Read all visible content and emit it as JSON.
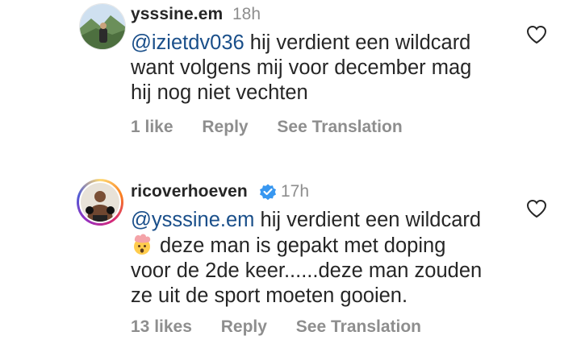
{
  "comments": [
    {
      "username": "ysssine.em",
      "time": "18h",
      "mention": "@izietdv036",
      "line1_rest": " hij verdient een wildcard",
      "line2": "want volgens mij voor december mag",
      "line3": "hij nog niet vechten",
      "likes": "1 like",
      "reply_label": "Reply",
      "translate_label": "See Translation",
      "avatar_icon": "landscape-avatar",
      "like_icon": "heart-outline-icon"
    },
    {
      "username": "ricoverhoeven",
      "verified_icon": "verified-badge-icon",
      "time": "17h",
      "mention": "@ysssine.em",
      "line1_rest": " hij verdient een wildcard",
      "emoji_icon": "exploding-head-emoji",
      "line2": "deze man is gepakt met doping",
      "line3": "voor de 2de keer......deze man zouden",
      "line4": "ze uit de sport moeten gooien.",
      "likes": "13 likes",
      "reply_label": "Reply",
      "translate_label": "See Translation",
      "avatar_icon": "boxer-avatar",
      "like_icon": "heart-outline-icon"
    }
  ],
  "colors": {
    "mention": "#1a4f8a",
    "muted": "#8e8e8e",
    "verified": "#3897f0"
  }
}
